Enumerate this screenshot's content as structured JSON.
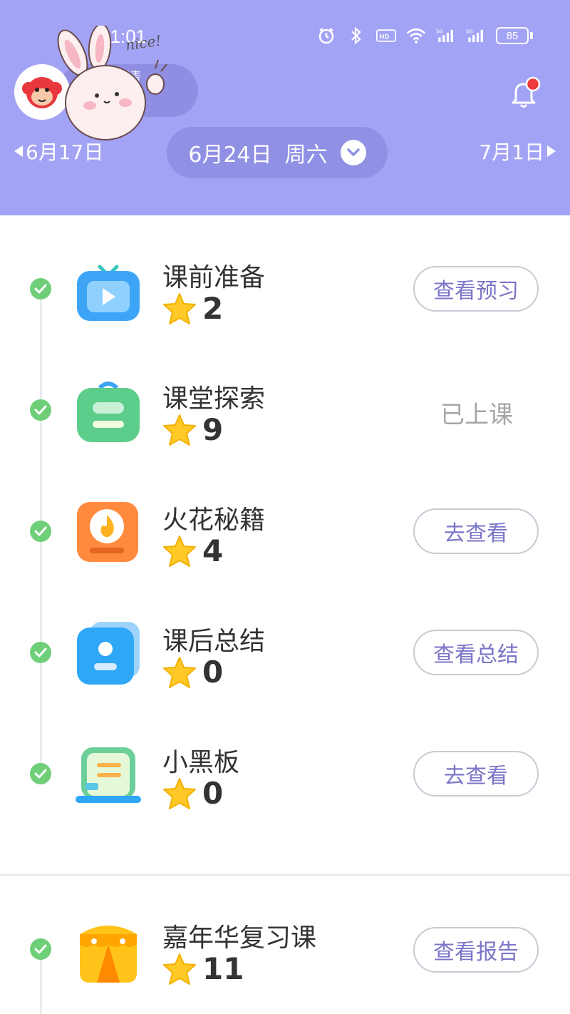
{
  "status_bar": {
    "time": "11:01",
    "battery": "85",
    "icons": [
      "alarm-icon",
      "bluetooth-icon",
      "hd-icon",
      "wifi-icon",
      "signal-5g-icon",
      "signal-5g-icon"
    ]
  },
  "header": {
    "pill_label": "请",
    "sticker_text": "nice!",
    "notification_badge": true
  },
  "date_nav": {
    "prev": "6月17日",
    "current_date": "6月24日",
    "current_weekday": "周六",
    "next": "7月1日"
  },
  "items": [
    {
      "title": "课前准备",
      "stars": "2",
      "action": "查看预习",
      "action_type": "button",
      "icon": "video-icon",
      "color": "#3ea5f6"
    },
    {
      "title": "课堂探索",
      "stars": "9",
      "action": "已上课",
      "action_type": "text",
      "icon": "backpack-icon",
      "color": "#5ccd8a"
    },
    {
      "title": "火花秘籍",
      "stars": "4",
      "action": "去查看",
      "action_type": "button",
      "icon": "flame-book-icon",
      "color": "#ff8a3d"
    },
    {
      "title": "课后总结",
      "stars": "0",
      "action": "查看总结",
      "action_type": "button",
      "icon": "user-card-icon",
      "color": "#2ea7f7"
    },
    {
      "title": "小黑板",
      "stars": "0",
      "action": "去查看",
      "action_type": "button",
      "icon": "blackboard-icon",
      "color": "#6ccf9a"
    }
  ],
  "review": {
    "title": "嘉年华复习课",
    "stars": "11",
    "action": "查看报告",
    "icon": "tent-icon",
    "color": "#ffc31a"
  },
  "colors": {
    "header_bg": "#a3a3f5",
    "check": "#6fcf78",
    "accent": "#7b75c8",
    "star": "#ffc928"
  }
}
